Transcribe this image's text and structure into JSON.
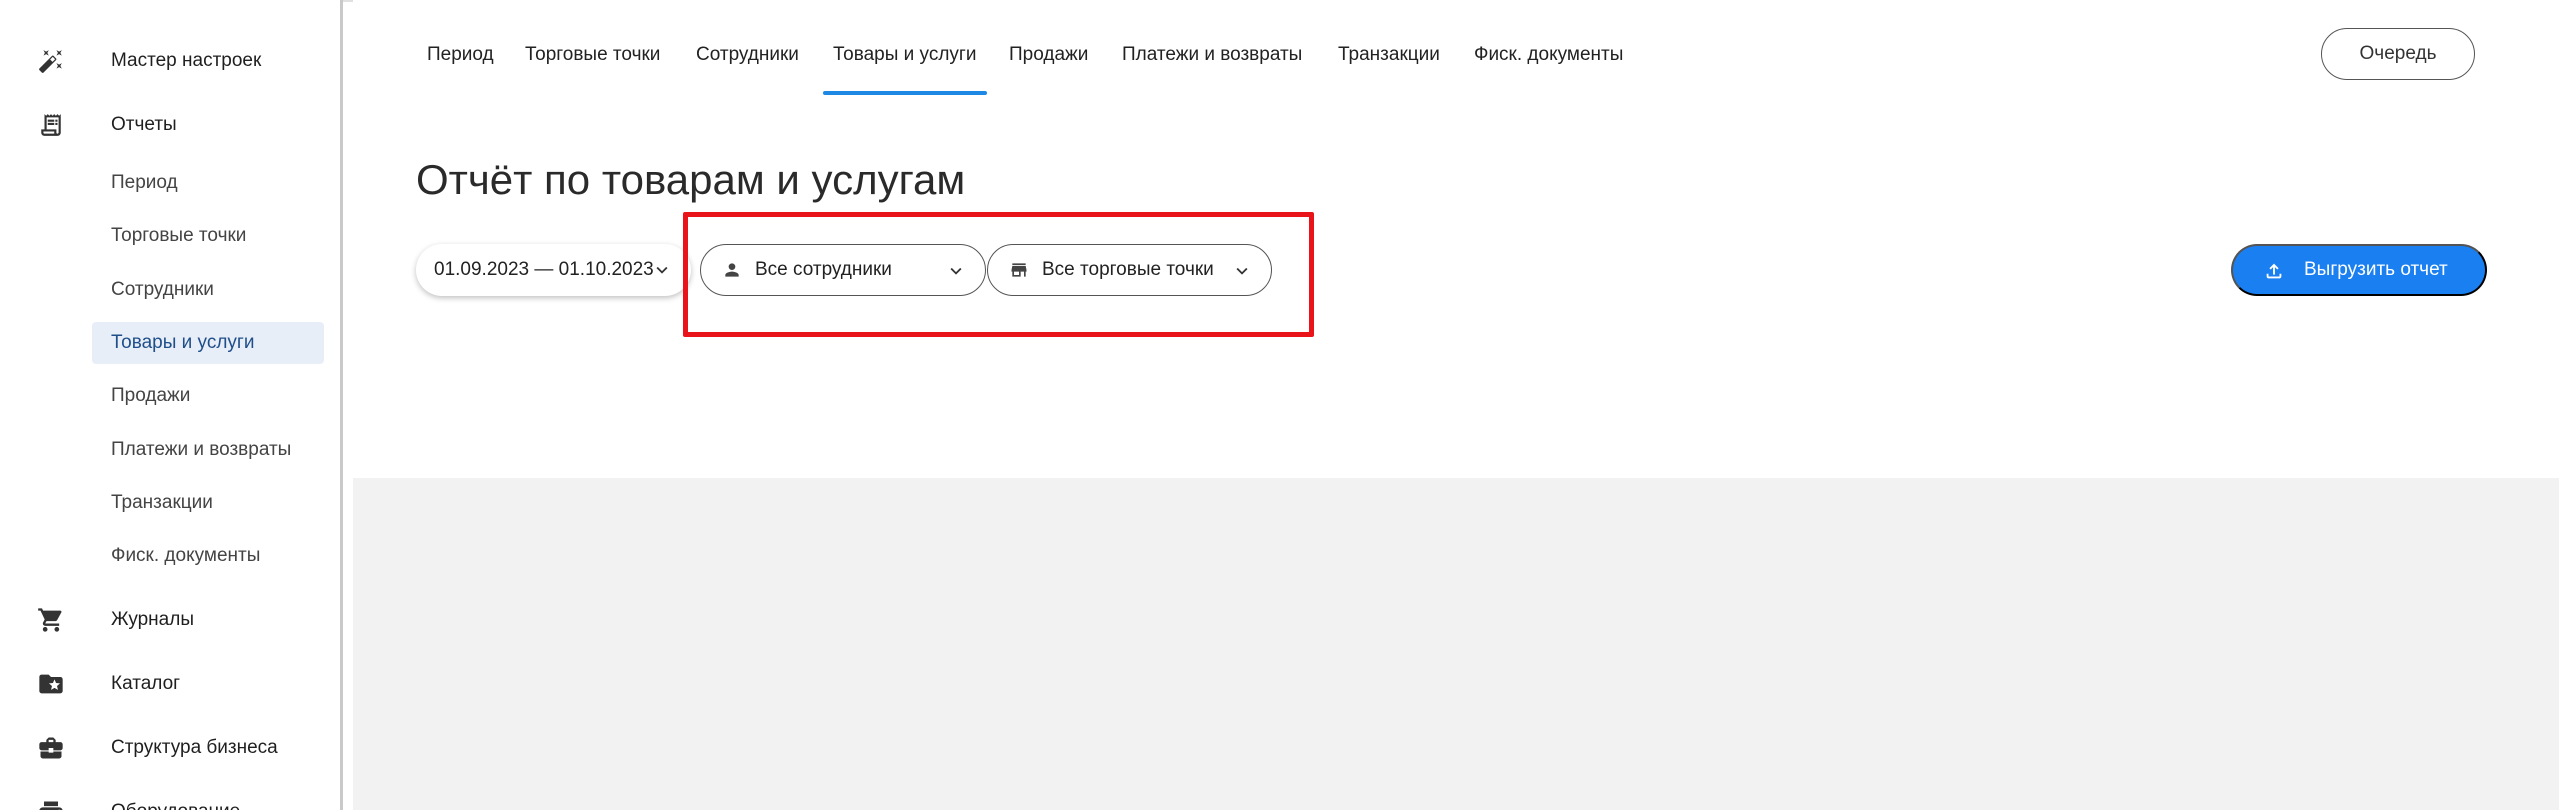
{
  "sidebar": {
    "sections": [
      {
        "label": "Мастер настроек",
        "icon": "magic-wand-icon"
      },
      {
        "label": "Отчеты",
        "icon": "receipt-icon"
      },
      {
        "label": "Журналы",
        "icon": "cart-icon"
      },
      {
        "label": "Каталог",
        "icon": "folder-star-icon"
      },
      {
        "label": "Структура бизнеса",
        "icon": "briefcase-icon"
      },
      {
        "label": "Оборудование",
        "icon": "printer-icon"
      }
    ],
    "report_items": [
      {
        "label": "Период"
      },
      {
        "label": "Торговые точки"
      },
      {
        "label": "Сотрудники"
      },
      {
        "label": "Товары и услуги",
        "active": true
      },
      {
        "label": "Продажи"
      },
      {
        "label": "Платежи и возвраты"
      },
      {
        "label": "Транзакции"
      },
      {
        "label": "Фиск. документы"
      }
    ]
  },
  "tabs": [
    {
      "label": "Период"
    },
    {
      "label": "Торговые точки"
    },
    {
      "label": "Сотрудники"
    },
    {
      "label": "Товары и услуги",
      "active": true
    },
    {
      "label": "Продажи"
    },
    {
      "label": "Платежи и возвраты"
    },
    {
      "label": "Транзакции"
    },
    {
      "label": "Фиск. документы"
    }
  ],
  "queue_button": "Очередь",
  "page_title": "Отчёт по товарам и услугам",
  "filters": {
    "date_range": "01.09.2023 — 01.10.2023",
    "employees": "Все сотрудники",
    "stores": "Все торговые точки"
  },
  "export_button": "Выгрузить отчет",
  "colors": {
    "accent": "#1a7ff0",
    "tab_underline": "#1e88e5",
    "highlight_frame": "#e8141a",
    "active_nav_bg": "#e8eef7"
  }
}
